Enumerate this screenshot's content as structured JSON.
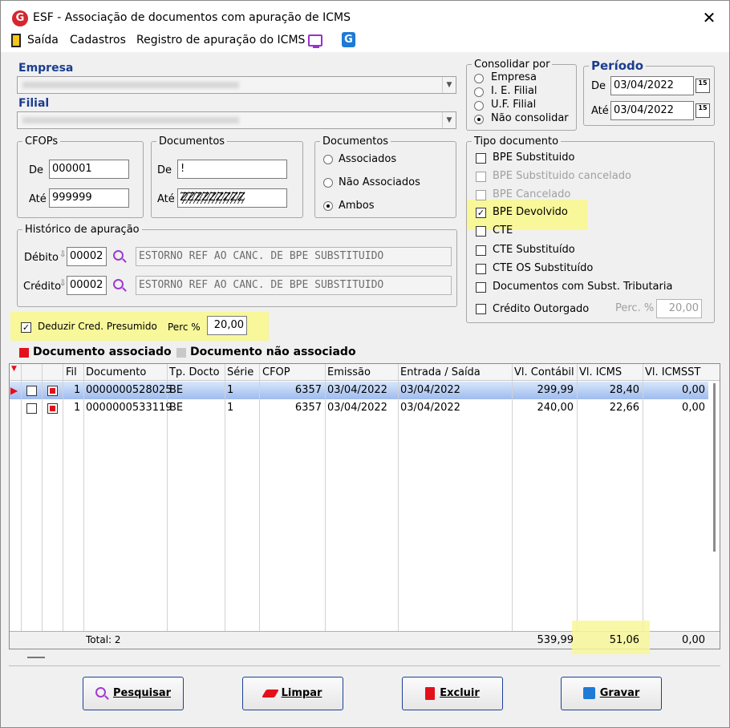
{
  "window": {
    "title": "ESF - Associação de documentos com apuração de ICMS",
    "close": "✕",
    "logo": "G"
  },
  "menu": {
    "saida": "Saída",
    "cadastros": "Cadastros",
    "registro": "Registro de apuração do ICMS"
  },
  "empresa": {
    "label": "Empresa",
    "value": ""
  },
  "filial": {
    "label": "Filial",
    "value": ""
  },
  "consolidar": {
    "legend": "Consolidar por",
    "options": [
      "Empresa",
      "I. E. Filial",
      "U.F. Filial",
      "Não consolidar"
    ],
    "selected": "Não consolidar"
  },
  "periodo": {
    "legend": "Período",
    "de_label": "De",
    "de": "03/04/2022",
    "ate_label": "Até",
    "ate": "03/04/2022",
    "cal": "15"
  },
  "cfops": {
    "legend": "CFOPs",
    "de_label": "De",
    "de": "000001",
    "ate_label": "Até",
    "ate": "999999"
  },
  "documentos_range": {
    "legend": "Documentos",
    "de_label": "De",
    "de": "!",
    "ate_label": "Até",
    "ate": "ZZZZZZZZZ"
  },
  "documentos_filter": {
    "legend": "Documentos",
    "options": [
      "Associados",
      "Não Associados",
      "Ambos"
    ],
    "selected": "Ambos"
  },
  "tipo_documento": {
    "legend": "Tipo documento",
    "items": [
      {
        "label": "BPE Substituido",
        "checked": false,
        "disabled": false
      },
      {
        "label": "BPE Substituido cancelado",
        "checked": false,
        "disabled": true
      },
      {
        "label": "BPE Cancelado",
        "checked": false,
        "disabled": true
      },
      {
        "label": "BPE Devolvido",
        "checked": true,
        "disabled": false
      },
      {
        "label": "CTE",
        "checked": false,
        "disabled": false
      },
      {
        "label": "CTE Substituído",
        "checked": false,
        "disabled": false
      },
      {
        "label": "CTE OS Substituído",
        "checked": false,
        "disabled": false
      },
      {
        "label": "Documentos com Subst. Tributaria",
        "checked": false,
        "disabled": false
      },
      {
        "label": "Crédito Outorgado",
        "checked": false,
        "disabled": false
      }
    ],
    "perc_label": "Perc. %",
    "perc_value": "20,00"
  },
  "historico": {
    "legend": "Histórico de apuração",
    "debito_label": "Débito",
    "debito_code": "00002",
    "debito_desc": "ESTORNO REF AO CANC. DE BPE SUBSTITUIDO",
    "credito_label": "Crédito",
    "credito_code": "00002",
    "credito_desc": "ESTORNO REF AO CANC. DE BPE SUBSTITUIDO"
  },
  "deduzir": {
    "label": "Deduzir Cred. Presumido",
    "checked": true,
    "perc_label": "Perc %",
    "perc_value": "20,00"
  },
  "legend": {
    "associado": "Documento associado",
    "nao_associado": "Documento não associado",
    "associado_color": "#e3101b",
    "nao_associado_color": "#c8c8c8"
  },
  "grid": {
    "headers": [
      "Fil",
      "Documento",
      "Tp. Docto",
      "Série",
      "CFOP",
      "Emissão",
      "Entrada / Saída",
      "Vl. Contábil",
      "Vl. ICMS",
      "Vl. ICMSST"
    ],
    "rows": [
      {
        "fil": "1",
        "documento": "0000000528025",
        "tp": "BE",
        "serie": "1",
        "cfop": "6357",
        "emissao": "03/04/2022",
        "entrada": "03/04/2022",
        "contabil": "299,99",
        "icms": "28,40",
        "icmsst": "0,00"
      },
      {
        "fil": "1",
        "documento": "0000000533119",
        "tp": "BE",
        "serie": "1",
        "cfop": "6357",
        "emissao": "03/04/2022",
        "entrada": "03/04/2022",
        "contabil": "240,00",
        "icms": "22,66",
        "icmsst": "0,00"
      }
    ],
    "total_label": "Total: 2",
    "total_contabil": "539,99",
    "total_icms": "51,06",
    "total_icmsst": "0,00"
  },
  "buttons": {
    "pesquisar": "Pesquisar",
    "limpar": "Limpar",
    "excluir": "Excluir",
    "gravar": "Gravar"
  },
  "colors": {
    "highlight": "#f8f79a",
    "accent_blue": "#1a3d8f",
    "button_border": "#1c3f98"
  }
}
